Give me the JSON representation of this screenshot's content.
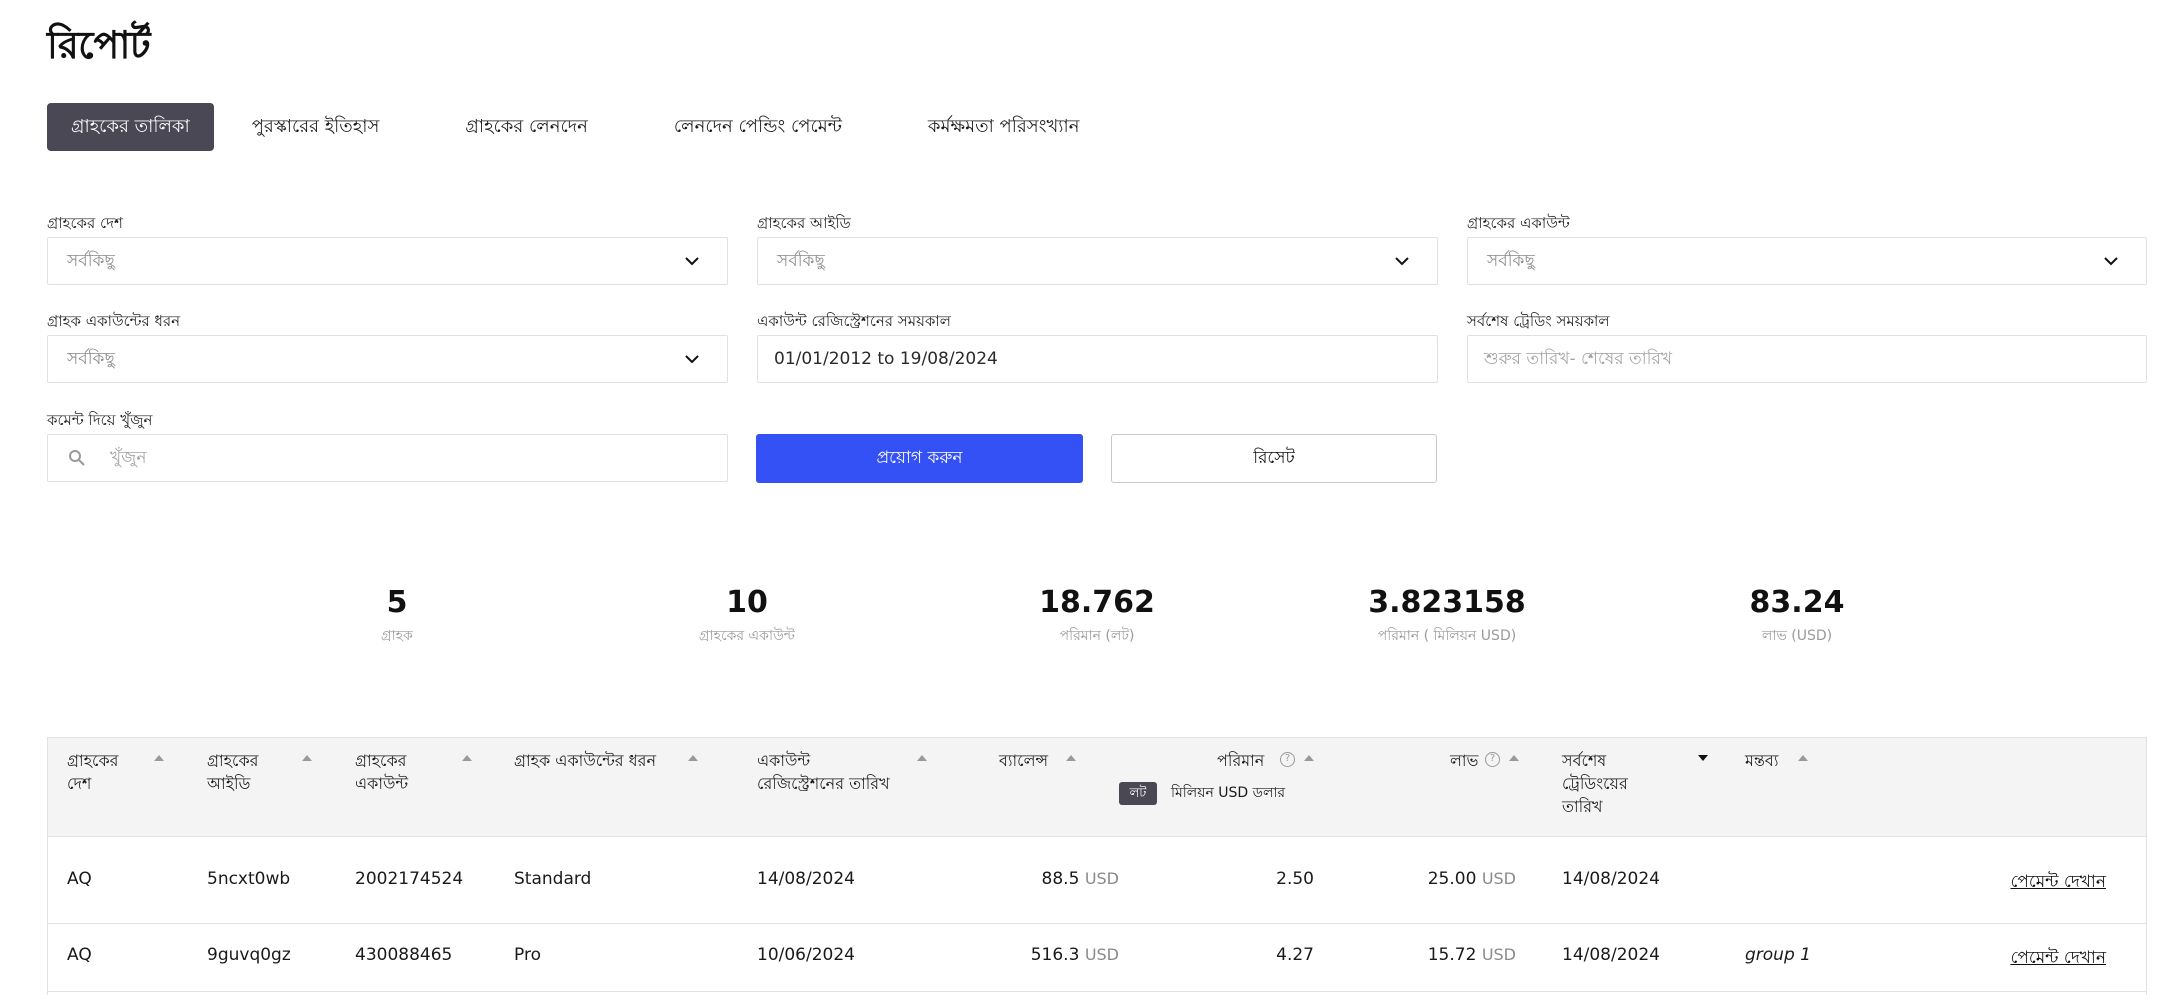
{
  "page": {
    "title": "রিপোর্ট"
  },
  "tabs": [
    {
      "label": "গ্রাহকের তালিকা",
      "active": true
    },
    {
      "label": "পুরস্কারের ইতিহাস"
    },
    {
      "label": "গ্রাহকের লেনদেন"
    },
    {
      "label": "লেনদেন পেন্ডিং পেমেন্ট"
    },
    {
      "label": "কর্মক্ষমতা পরিসংখ্যান"
    }
  ],
  "filters": {
    "client_country": {
      "label": "গ্রাহকের দেশ",
      "value": "সর্বকিছু"
    },
    "client_id": {
      "label": "গ্রাহকের আইডি",
      "value": "সর্বকিছু"
    },
    "client_account": {
      "label": "গ্রাহকের একাউন্ট",
      "value": "সর্বকিছু"
    },
    "account_type": {
      "label": "গ্রাহক একাউন্টের ধরন",
      "value": "সর্বকিছু"
    },
    "registration_period": {
      "label": "একাউন্ট রেজিস্ট্রেশনের সময়কাল",
      "value": "01/01/2012 to 19/08/2024"
    },
    "last_trading_period": {
      "label": "সর্বশেষ ট্রেডিং সময়কাল",
      "placeholder": "শুরুর তারিখ- শেষের তারিখ"
    },
    "comment_search": {
      "label": "কমেন্ট দিয়ে খুঁজুন",
      "placeholder": "খুঁজুন"
    },
    "apply_label": "প্রয়োগ করুন",
    "reset_label": "রিসেট"
  },
  "stats": [
    {
      "value": "5",
      "label": "গ্রাহক"
    },
    {
      "value": "10",
      "label": "গ্রাহকের একাউন্ট"
    },
    {
      "value": "18.762",
      "label": "পরিমান (লট)"
    },
    {
      "value": "3.823158",
      "label": "পরিমান ( মিলিয়ন USD)"
    },
    {
      "value": "83.24",
      "label": "লাভ (USD)"
    }
  ],
  "table": {
    "headers": {
      "country": [
        "গ্রাহকের",
        "দেশ"
      ],
      "client_id": [
        "গ্রাহকের",
        "আইডি"
      ],
      "account": [
        "গ্রাহকের",
        "একাউন্ট"
      ],
      "account_type": "গ্রাহক একাউন্টের ধরন",
      "reg_date": [
        "একাউন্ট",
        "রেজিস্ট্রেশনের তারিখ"
      ],
      "balance": "ব্যালেন্স",
      "volume": "পরিমান",
      "profit": "লাভ",
      "last_trade": [
        "সর্বশেষ",
        "ট্রেডিংয়ের",
        "তারিখ"
      ],
      "comment": "মন্তব্য",
      "volume_toggle_lot": "লট",
      "volume_toggle_usd": "মিলিয়ন USD ডলার"
    },
    "rows": [
      {
        "country": "AQ",
        "client_id": "5ncxt0wb",
        "account": "2002174524",
        "account_type": "Standard",
        "reg_date": "14/08/2024",
        "balance": "88.5",
        "balance_unit": "USD",
        "volume": "2.50",
        "profit": "25.00",
        "profit_unit": "USD",
        "last_trade": "14/08/2024",
        "comment": "",
        "action": "পেমেন্ট দেখান"
      },
      {
        "country": "AQ",
        "client_id": "9guvq0gz",
        "account": "430088465",
        "account_type": "Pro",
        "reg_date": "10/06/2024",
        "balance": "516.3",
        "balance_unit": "USD",
        "volume": "4.27",
        "profit": "15.72",
        "profit_unit": "USD",
        "last_trade": "14/08/2024",
        "comment": "group 1",
        "action": "পেমেন্ট দেখান"
      }
    ]
  },
  "colors": {
    "primary": "#3451f5",
    "tab_active": "#4a4854",
    "muted": "#9a9a9a"
  },
  "icons": {
    "dropdown": "chevron-down-icon",
    "search": "search-icon",
    "help": "help-circle-icon",
    "sort": "sort-arrow-icon"
  }
}
